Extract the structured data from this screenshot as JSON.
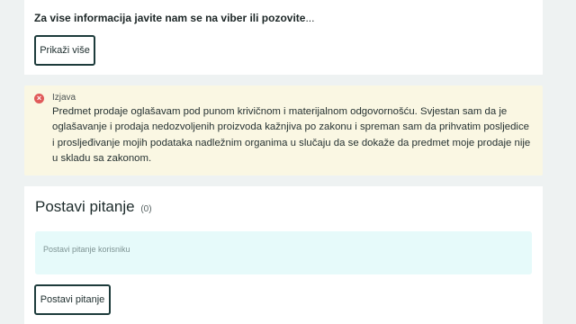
{
  "info": {
    "text": "Za vise informacija javite nam se na viber ili pozovite",
    "ellipsis": "...",
    "more_button": "Prikaži više"
  },
  "warning": {
    "title": "Izjava",
    "body": "Predmet prodaje oglašavam pod punom krivičnom i materijalnom odgovornošću. Svjestan sam da je oglašavanje i prodaja nedozvoljenih proizvoda kažnjiva po zakonu i spreman sam da prihvatim posljedice i prosljeđivanje mojih podataka nadležnim organima u slučaju da se dokaže da predmet moje prodaje nije u skladu sa zakonom.",
    "icon": "error-circle-icon",
    "icon_color": "#e05a5a"
  },
  "questions": {
    "title": "Postavi pitanje",
    "count": "(0)",
    "input_placeholder": "Postavi pitanje korisniku",
    "submit_button": "Postavi pitanje"
  }
}
